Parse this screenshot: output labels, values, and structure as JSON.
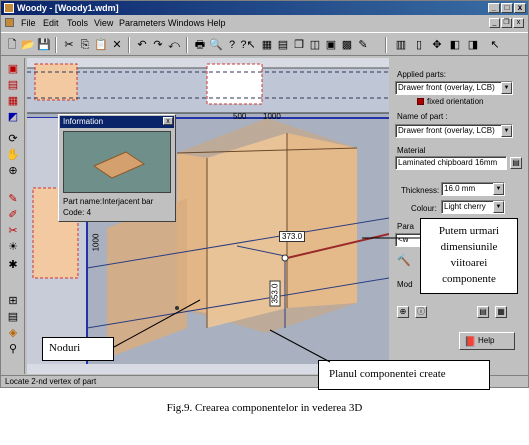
{
  "window": {
    "title": "Woody - [Woody1.wdm]",
    "min_btn": "_",
    "max_btn": "□",
    "close_btn": "x",
    "mdi_min": "_",
    "mdi_restore": "❐",
    "mdi_close": "x"
  },
  "menu": {
    "items": [
      "File",
      "Edit",
      "Tools",
      "View",
      "Parameters",
      "Windows",
      "Help"
    ]
  },
  "toolbar": {
    "icons": [
      "new-icon",
      "open-icon",
      "save-icon",
      "cut-icon",
      "copy-icon",
      "paste-icon",
      "undo-icon",
      "redo-icon",
      "print-icon",
      "zoom-icon",
      "help-icon",
      "whats-this-icon"
    ]
  },
  "viewport": {
    "ruler_top_labels": [
      "500",
      "1000"
    ],
    "ruler_left_label": "1000",
    "dimension_horizontal": "373.0",
    "dimension_vertical": "353.0"
  },
  "info_window": {
    "title": "Information",
    "close": "x",
    "part_name": "Part name:Interjacent bar",
    "code": "Code: 4"
  },
  "right_panel": {
    "applied_parts_label": "Applied parts:",
    "applied_parts_value": "Drawer front (overlay, LCB)",
    "fixed_orientation_label": "fixed orientation",
    "name_of_part_label": "Name of part :",
    "name_of_part_value": "Drawer front (overlay, LCB)",
    "material_label": "Material",
    "material_value": "Laminated chipboard 16mm",
    "thickness_label": "Thickness:",
    "thickness_value": "16.0 mm",
    "colour_label": "Colour:",
    "colour_value": "Light cherry",
    "params_label": "Para",
    "params_value": "<w",
    "mode_label": "Mod",
    "help_label": "Help"
  },
  "status": {
    "text": "Locate 2-nd vertex of part"
  },
  "callouts": {
    "dimensions": [
      "Putem urmari",
      "dimensiunile",
      "viitoarei",
      "componente"
    ],
    "nodes": "Noduri",
    "plane": "Planul componentei create"
  },
  "caption": "Fig.9. Crearea componentelor in vederea 3D"
}
